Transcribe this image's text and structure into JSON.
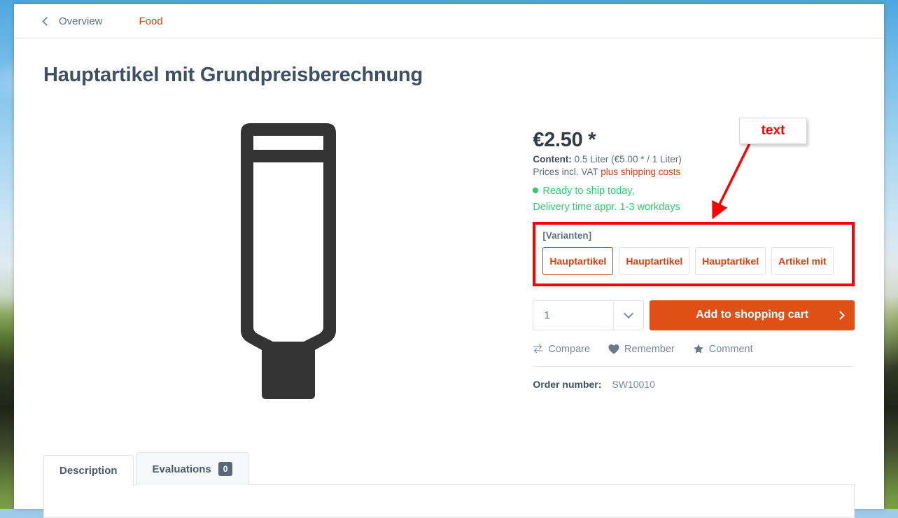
{
  "breadcrumb": {
    "back_label": "Overview",
    "back_icon": "chevron-left-icon",
    "category_label": "Food"
  },
  "product": {
    "title": "Hauptartikel mit Grundpreisberechnung",
    "image_icon": "tube-product-icon",
    "price": "€2.50 *",
    "content_label": "Content:",
    "content_value": "0.5 Liter (€5.00 * / 1 Liter)",
    "vat_text": "Prices incl. VAT",
    "shipping_link": "plus shipping costs",
    "availability_line1": "Ready to ship today,",
    "availability_line2": "Delivery time appr. 1-3 workdays",
    "availability_color": "#2ecc71",
    "order_number_label": "Order number:",
    "order_number_value": "SW10010"
  },
  "variants": {
    "label": "[Varianten]",
    "options": [
      {
        "label": "Hauptartikel",
        "selected": true
      },
      {
        "label": "Hauptartikel",
        "selected": false
      },
      {
        "label": "Hauptartikel",
        "selected": false
      },
      {
        "label": "Artikel mit",
        "selected": false
      }
    ],
    "highlight_color": "#ff0000"
  },
  "buy": {
    "quantity_value": "1",
    "quantity_caret_icon": "chevron-down-icon",
    "add_to_cart_label": "Add to shopping cart",
    "add_to_cart_arrow_icon": "chevron-right-icon",
    "add_to_cart_color": "#e04f16"
  },
  "actions": [
    {
      "label": "Compare",
      "icon": "compare-arrows-icon"
    },
    {
      "label": "Remember",
      "icon": "heart-icon"
    },
    {
      "label": "Comment",
      "icon": "star-icon"
    }
  ],
  "tabs": [
    {
      "label": "Description",
      "badge": "",
      "active": true
    },
    {
      "label": "Evaluations",
      "badge": "0",
      "active": false
    }
  ],
  "annotation": {
    "text": "text",
    "color": "#ff0000"
  }
}
